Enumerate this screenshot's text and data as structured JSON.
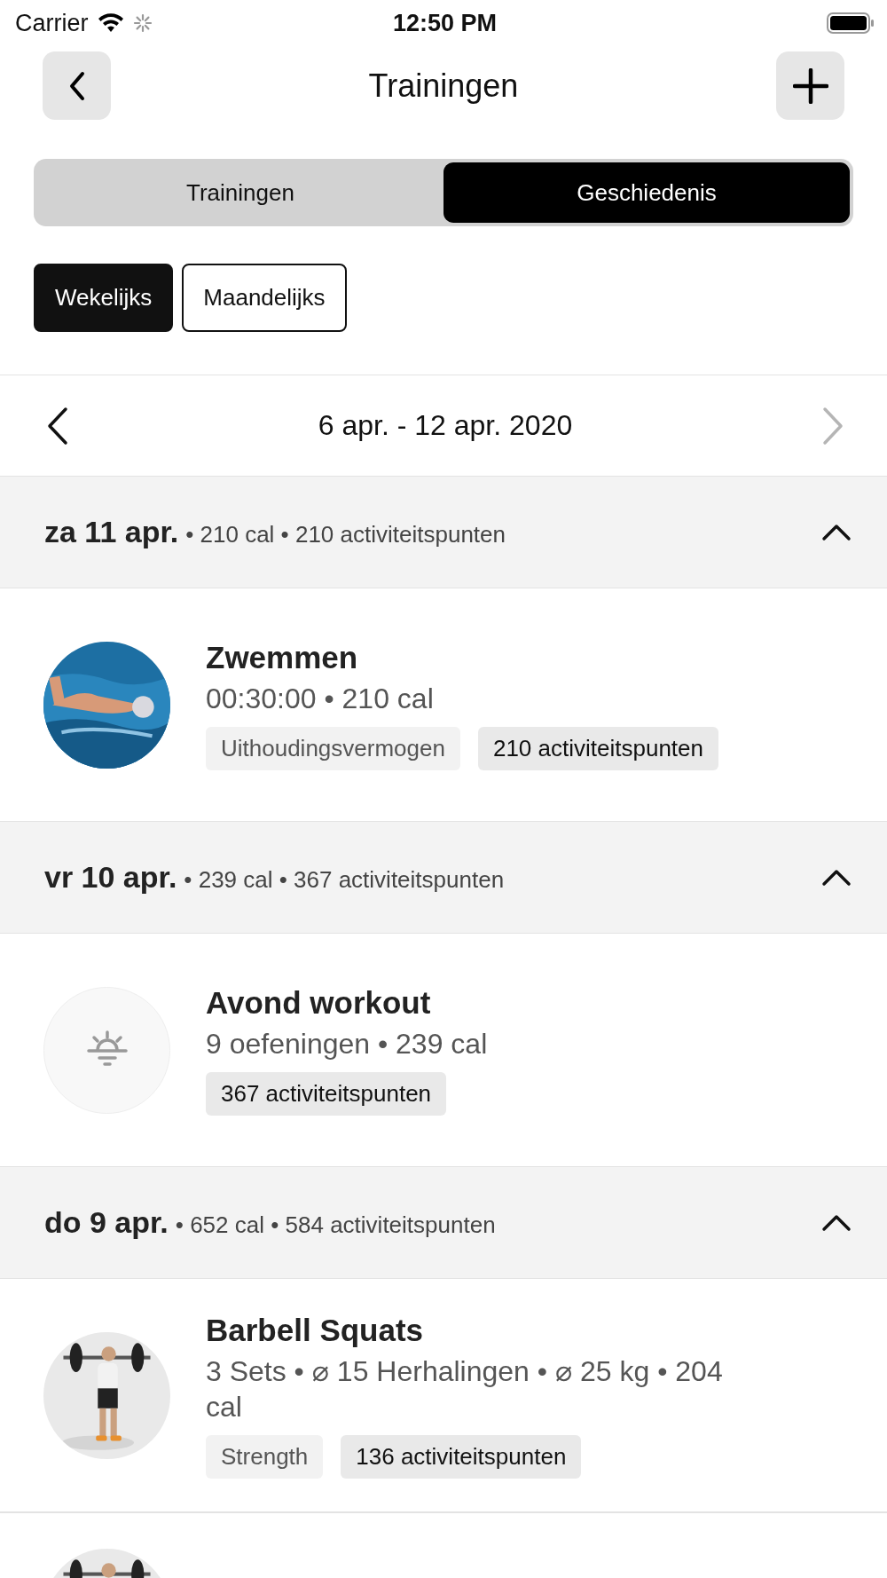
{
  "status_bar": {
    "carrier": "Carrier",
    "time": "12:50 PM"
  },
  "nav": {
    "title": "Trainingen"
  },
  "tabs": [
    {
      "label": "Trainingen",
      "selected": false
    },
    {
      "label": "Geschiedenis",
      "selected": true
    }
  ],
  "periods": [
    {
      "label": "Wekelijks",
      "selected": true
    },
    {
      "label": "Maandelijks",
      "selected": false
    }
  ],
  "week": {
    "label": "6 apr. - 12 apr. 2020",
    "next_disabled": true
  },
  "days": [
    {
      "date": "za 11 apr.",
      "summary": "• 210 cal • 210 activiteitspunten",
      "expanded": true,
      "workouts": [
        {
          "kind": "picture",
          "title": "Zwemmen",
          "details": "00:30:00 • 210 cal",
          "tags": [
            {
              "kind": "category",
              "label": "Uithoudingsvermogen"
            },
            {
              "kind": "points",
              "label": "210 activiteitspunten"
            }
          ]
        }
      ]
    },
    {
      "date": "vr 10 apr.",
      "summary": "• 239 cal • 367 activiteitspunten",
      "expanded": true,
      "workouts": [
        {
          "kind": "sunrise",
          "title": "Avond workout",
          "details": "9 oefeningen • 239 cal",
          "tags": [
            {
              "kind": "points",
              "label": "367 activiteitspunten"
            }
          ]
        }
      ]
    },
    {
      "date": "do 9 apr.",
      "summary": "• 652 cal • 584 activiteitspunten",
      "expanded": true,
      "workouts": [
        {
          "kind": "picture",
          "title": "Barbell Squats",
          "details": "3 Sets • ⌀ 15 Herhalingen • ⌀ 25 kg • 204 cal",
          "tags": [
            {
              "kind": "category",
              "label": "Strength"
            },
            {
              "kind": "points",
              "label": "136 activiteitspunten"
            }
          ]
        },
        {
          "kind": "picture"
        }
      ]
    }
  ]
}
